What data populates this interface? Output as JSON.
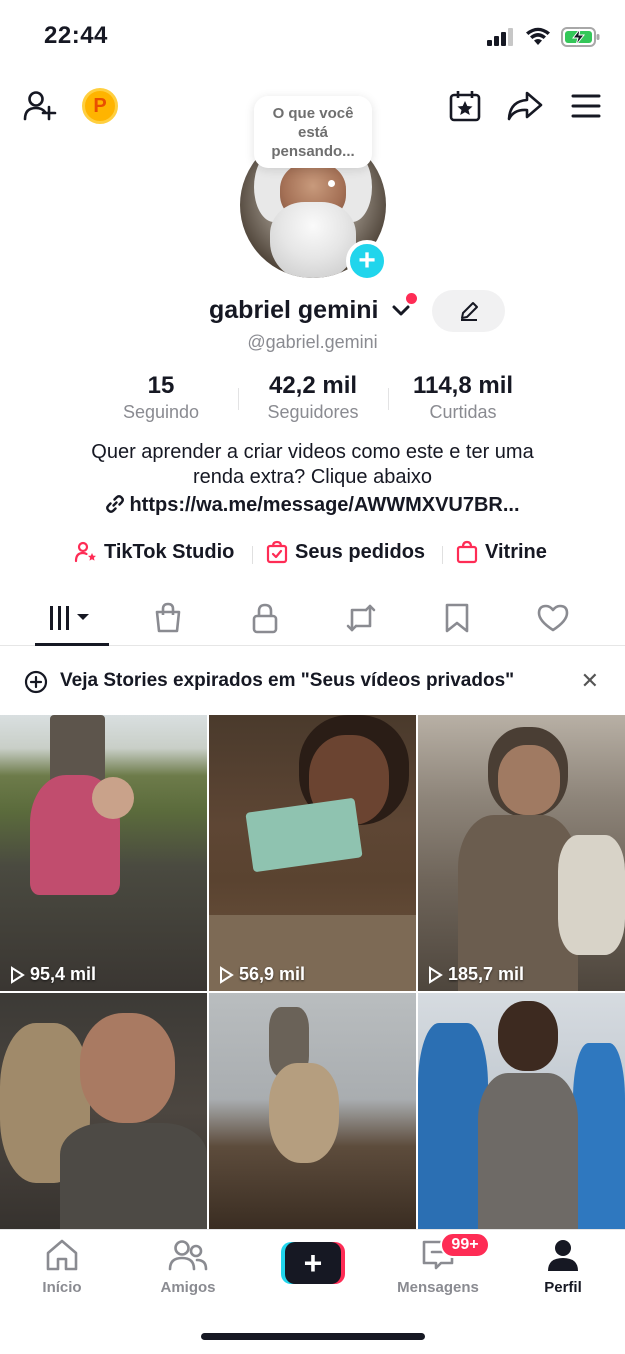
{
  "status_bar": {
    "time": "22:44"
  },
  "bubble": {
    "text_line1": "O que você",
    "text_line2": "está",
    "text_line3": "pensando..."
  },
  "profile": {
    "display_name": "gabriel gemini",
    "handle": "@gabriel.gemini",
    "bio_line1": "Quer aprender a criar videos como este e ter uma",
    "bio_line2": "renda extra? Clique abaixo",
    "link": "https://wa.me/message/AWWMXVU7BR..."
  },
  "stats": [
    {
      "value": "15",
      "label": "Seguindo"
    },
    {
      "value": "42,2 mil",
      "label": "Seguidores"
    },
    {
      "value": "114,8 mil",
      "label": "Curtidas"
    }
  ],
  "shortcuts": [
    {
      "label": "TikTok Studio",
      "icon": "person-star-icon"
    },
    {
      "label": "Seus pedidos",
      "icon": "order-bag-icon"
    },
    {
      "label": "Vitrine",
      "icon": "shop-bag-icon"
    }
  ],
  "tabs": [
    {
      "name": "videos",
      "icon": "grid-bars-icon"
    },
    {
      "name": "shop",
      "icon": "shopping-bag-icon"
    },
    {
      "name": "private",
      "icon": "lock-icon"
    },
    {
      "name": "reposts",
      "icon": "repost-icon"
    },
    {
      "name": "favorites",
      "icon": "bookmark-icon"
    },
    {
      "name": "liked",
      "icon": "heart-icon"
    }
  ],
  "stories_banner": {
    "text": "Veja Stories expirados em \"Seus vídeos privados\"",
    "close": "✕"
  },
  "videos": [
    {
      "views": "95,4 mil"
    },
    {
      "views": "56,9 mil"
    },
    {
      "views": "185,7 mil"
    },
    {
      "views": ""
    },
    {
      "views": ""
    },
    {
      "views": ""
    }
  ],
  "bottom_nav": {
    "home": "Início",
    "friends": "Amigos",
    "create": "+",
    "inbox": "Mensagens",
    "inbox_badge": "99+",
    "profile": "Perfil"
  },
  "colors": {
    "accent_red": "#fe2c55",
    "accent_cyan": "#20d5ec",
    "text": "#161823",
    "muted": "#8a8b91"
  }
}
